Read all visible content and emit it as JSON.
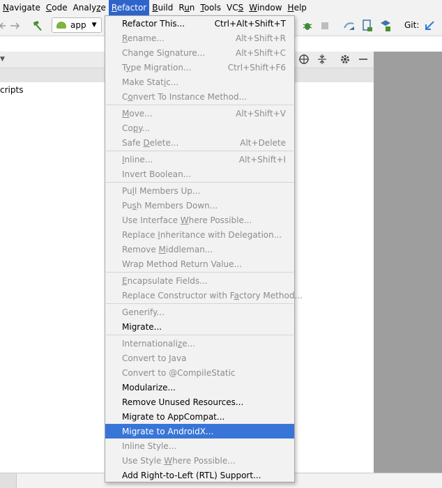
{
  "menubar": [
    {
      "before": "",
      "mnemonic": "N",
      "after": "avigate"
    },
    {
      "before": "",
      "mnemonic": "C",
      "after": "ode"
    },
    {
      "before": "Analy",
      "mnemonic": "z",
      "after": "e"
    },
    {
      "before": "",
      "mnemonic": "R",
      "after": "efactor"
    },
    {
      "before": "",
      "mnemonic": "B",
      "after": "uild"
    },
    {
      "before": "R",
      "mnemonic": "u",
      "after": "n"
    },
    {
      "before": "",
      "mnemonic": "T",
      "after": "ools"
    },
    {
      "before": "VC",
      "mnemonic": "S",
      "after": ""
    },
    {
      "before": "",
      "mnemonic": "W",
      "after": "indow"
    },
    {
      "before": "",
      "mnemonic": "H",
      "after": "elp"
    }
  ],
  "toolbar": {
    "run_config": "app",
    "git_label": "Git:",
    "icons": [
      "back-arrow-icon",
      "forward-arrow-icon",
      "build-hammer-icon",
      "android-icon",
      "dropdown-caret-icon",
      "debug-icon",
      "stop-icon",
      "sync-gradle-icon",
      "device-manager-icon",
      "sdk-manager-icon",
      "vcs-update-icon"
    ]
  },
  "tool_window": {
    "tree_text": "cripts",
    "icons": [
      "crosshair-icon",
      "collapse-icon",
      "gear-icon",
      "minimize-icon",
      "dropdown-caret-icon"
    ]
  },
  "refactor_menu": {
    "items": [
      {
        "before": "Refactor This...",
        "mnemonic": "",
        "after": "",
        "shortcut": "Ctrl+Alt+Shift+T",
        "state": "enabled"
      },
      {
        "before": "",
        "mnemonic": "R",
        "after": "ename...",
        "shortcut": "Alt+Shift+R",
        "state": "disabled"
      },
      {
        "before": "Change Si",
        "mnemonic": "g",
        "after": "nature...",
        "shortcut": "Alt+Shift+C",
        "state": "disabled"
      },
      {
        "before": "T",
        "mnemonic": "y",
        "after": "pe Migration...",
        "shortcut": "Ctrl+Shift+F6",
        "state": "disabled"
      },
      {
        "before": "Make Stat",
        "mnemonic": "i",
        "after": "c...",
        "shortcut": "",
        "state": "disabled"
      },
      {
        "before": "C",
        "mnemonic": "o",
        "after": "nvert To Instance Method...",
        "shortcut": "",
        "state": "disabled"
      },
      {
        "before": "",
        "mnemonic": "M",
        "after": "ove...",
        "shortcut": "Alt+Shift+V",
        "state": "disabled",
        "sep_before": true
      },
      {
        "before": "Co",
        "mnemonic": "p",
        "after": "y...",
        "shortcut": "",
        "state": "disabled"
      },
      {
        "before": "Safe ",
        "mnemonic": "D",
        "after": "elete...",
        "shortcut": "Alt+Delete",
        "state": "disabled"
      },
      {
        "before": "",
        "mnemonic": "I",
        "after": "nline...",
        "shortcut": "Alt+Shift+I",
        "state": "disabled",
        "sep_before": true
      },
      {
        "before": "Invert Boolean...",
        "mnemonic": "",
        "after": "",
        "shortcut": "",
        "state": "disabled"
      },
      {
        "before": "Pu",
        "mnemonic": "l",
        "after": "l Members Up...",
        "shortcut": "",
        "state": "disabled",
        "sep_before": true
      },
      {
        "before": "Pu",
        "mnemonic": "s",
        "after": "h Members Down...",
        "shortcut": "",
        "state": "disabled"
      },
      {
        "before": "Use Interface ",
        "mnemonic": "W",
        "after": "here Possible...",
        "shortcut": "",
        "state": "disabled"
      },
      {
        "before": "Replace ",
        "mnemonic": "I",
        "after": "nheritance with Delegation...",
        "shortcut": "",
        "state": "disabled"
      },
      {
        "before": "Remove ",
        "mnemonic": "M",
        "after": "iddleman...",
        "shortcut": "",
        "state": "disabled"
      },
      {
        "before": "Wrap Method Return Value...",
        "mnemonic": "",
        "after": "",
        "shortcut": "",
        "state": "disabled"
      },
      {
        "before": "",
        "mnemonic": "E",
        "after": "ncapsulate Fields...",
        "shortcut": "",
        "state": "disabled",
        "sep_before": true
      },
      {
        "before": "Replace Constructor with F",
        "mnemonic": "a",
        "after": "ctory Method...",
        "shortcut": "",
        "state": "disabled"
      },
      {
        "before": "Generify...",
        "mnemonic": "",
        "after": "",
        "shortcut": "",
        "state": "disabled",
        "sep_before": true
      },
      {
        "before": "Migrate...",
        "mnemonic": "",
        "after": "",
        "shortcut": "",
        "state": "enabled"
      },
      {
        "before": "Internationali",
        "mnemonic": "z",
        "after": "e...",
        "shortcut": "",
        "state": "disabled",
        "sep_before": true
      },
      {
        "before": "Convert to Java",
        "mnemonic": "",
        "after": "",
        "shortcut": "",
        "state": "disabled"
      },
      {
        "before": "Convert to @CompileStatic",
        "mnemonic": "",
        "after": "",
        "shortcut": "",
        "state": "disabled"
      },
      {
        "before": "Modularize...",
        "mnemonic": "",
        "after": "",
        "shortcut": "",
        "state": "enabled"
      },
      {
        "before": "Remove Unused Resources...",
        "mnemonic": "",
        "after": "",
        "shortcut": "",
        "state": "enabled"
      },
      {
        "before": "Migrate to AppCompat...",
        "mnemonic": "",
        "after": "",
        "shortcut": "",
        "state": "enabled"
      },
      {
        "before": "Migrate to AndroidX...",
        "mnemonic": "",
        "after": "",
        "shortcut": "",
        "state": "selected"
      },
      {
        "before": "Inline Style...",
        "mnemonic": "",
        "after": "",
        "shortcut": "",
        "state": "disabled"
      },
      {
        "before": "Use Style ",
        "mnemonic": "W",
        "after": "here Possible...",
        "shortcut": "",
        "state": "disabled"
      },
      {
        "before": "Add Right-to-Left (RTL) Support...",
        "mnemonic": "",
        "after": "",
        "shortcut": "",
        "state": "enabled"
      }
    ]
  },
  "colors": {
    "active_menu": "#2f65ca",
    "selected_item": "#3875d7",
    "disabled_text": "#8c8c8c"
  }
}
